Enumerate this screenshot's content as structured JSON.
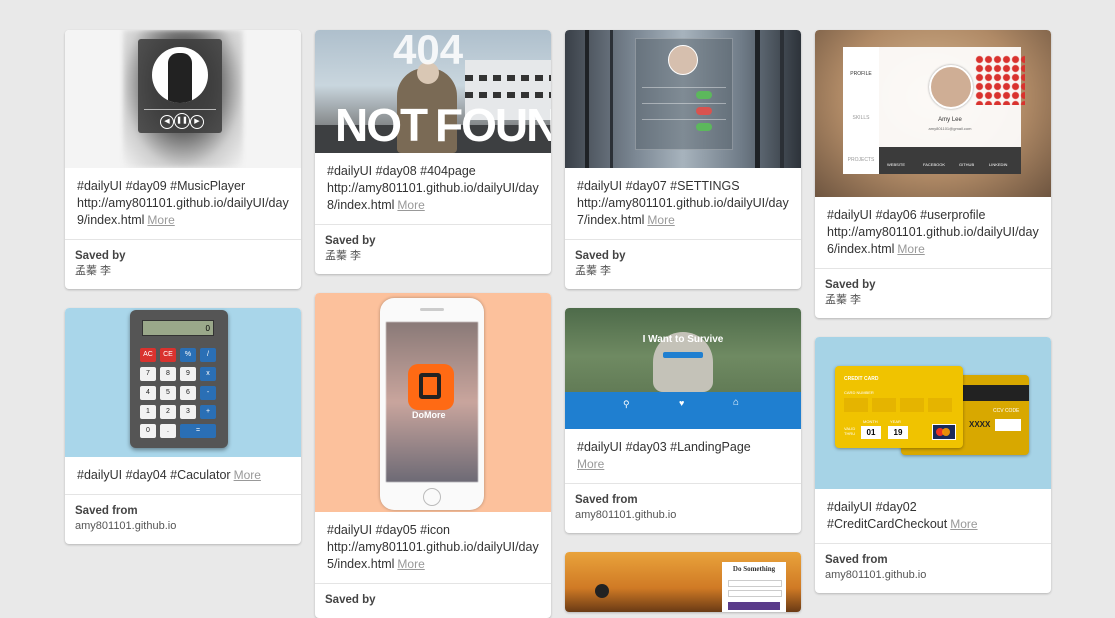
{
  "pins": [
    {
      "id": "day09",
      "description": "#dailyUI #day09 #MusicPlayer http://amy801101.github.io/dailyUI/day9/index.html",
      "more": "More",
      "saved_label": "Saved by",
      "saved_value": "孟蓁 李"
    },
    {
      "id": "day08",
      "description": "#dailyUI #day08 #404page http://amy801101.github.io/dailyUI/day8/index.html",
      "more": "More",
      "saved_label": "Saved by",
      "saved_value": "孟蓁 李",
      "image_text": {
        "top": "404",
        "bottom_left": "NOT",
        "bottom_right": "FOUND"
      }
    },
    {
      "id": "day07",
      "description": "#dailyUI #day07 #SETTINGS http://amy801101.github.io/dailyUI/day7/index.html",
      "more": "More",
      "saved_label": "Saved by",
      "saved_value": "孟蓁 李"
    },
    {
      "id": "day06",
      "description": "#dailyUI #day06 #userprofile http://amy801101.github.io/dailyUI/day6/index.html",
      "more": "More",
      "saved_label": "Saved by",
      "saved_value": "孟蓁 李",
      "image_text": {
        "name": "Amy Lee",
        "email": "amy801101@gmail.com",
        "tabs": [
          "PROFILE",
          "SKILLS",
          "PROJECTS"
        ],
        "links": [
          "WEBSITE",
          "FACEBOOK",
          "GITHUB",
          "LINKEDIN"
        ]
      }
    },
    {
      "id": "day04",
      "description": "#dailyUI #day04  #Caculator",
      "more": "More",
      "saved_label": "Saved from",
      "saved_value": "amy801101.github.io",
      "image_text": {
        "display": "0",
        "keys": [
          "AC",
          "CE",
          "%",
          "/",
          "7",
          "8",
          "9",
          "x",
          "4",
          "5",
          "6",
          "-",
          "1",
          "2",
          "3",
          "+",
          "0",
          ".",
          "="
        ]
      }
    },
    {
      "id": "day05",
      "description": "#dailyUI #day05 #icon http://amy801101.github.io/dailyUI/day5/index.html",
      "more": "More",
      "saved_label": "Saved by",
      "saved_value": "",
      "image_text": {
        "app": "DoMore"
      }
    },
    {
      "id": "day03",
      "description": "#dailyUI #day03 #LandingPage",
      "more": "More",
      "saved_label": "Saved from",
      "saved_value": "amy801101.github.io",
      "image_text": {
        "headline": "I Want to Survive"
      }
    },
    {
      "id": "day02",
      "description": "#dailyUI #day02 #CreditCardCheckout",
      "more": "More",
      "saved_label": "Saved from",
      "saved_value": "amy801101.github.io",
      "image_text": {
        "title": "CREDIT CARD",
        "card_number": "CARD NUMBER",
        "month": "MONTH",
        "year": "YEAR",
        "valid": "VALID THRU",
        "m": "01",
        "y": "19",
        "ccv": "CCV CODE",
        "ccv_val": "XXXX"
      }
    },
    {
      "id": "day01",
      "description": "",
      "image_text": {
        "title": "Do Something"
      }
    }
  ],
  "colors": {
    "background": "#e9e9e9",
    "more_link": "#999999",
    "landing_bar": "#1f7fd0",
    "credit_card": "#f0c300",
    "phone_bg": "#fcc19c",
    "calc_bg": "#a9d6ea",
    "card_bg": "#a6d3e6"
  }
}
